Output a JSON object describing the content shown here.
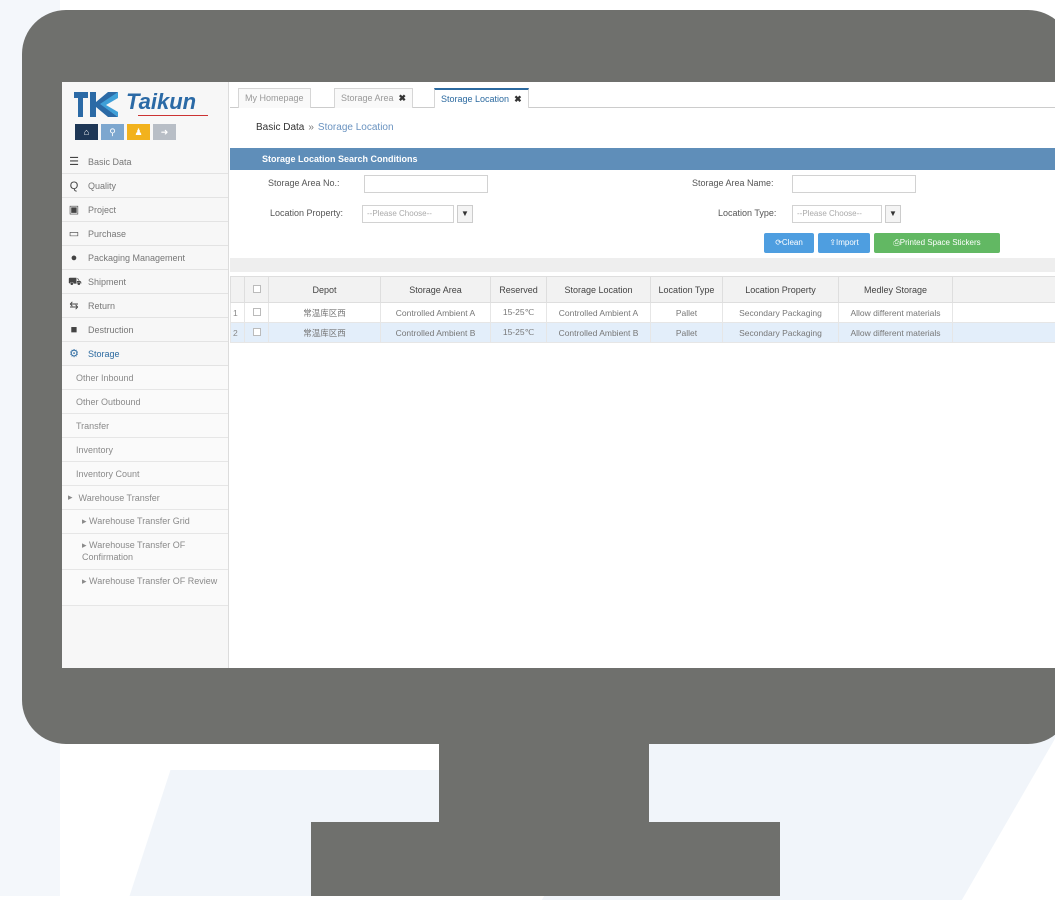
{
  "colors": {
    "monitor": "#6f706d",
    "accent": "#2c6aa0",
    "panel_header": "#5f8eb9",
    "button_blue": "#4e9ee0",
    "button_green": "#62b863",
    "selected_row": "#e3eefa"
  },
  "logo": {
    "name": "Taikun",
    "icon": "taikun-logo-mark"
  },
  "quickbar": {
    "icons": [
      "home-icon",
      "search-icon",
      "user-icon",
      "arrow-icon"
    ]
  },
  "sidebar": {
    "items": [
      {
        "label": "Basic Data",
        "icon": "database-icon"
      },
      {
        "label": "Quality",
        "icon": "search-icon"
      },
      {
        "label": "Project",
        "icon": "project-icon"
      },
      {
        "label": "Purchase",
        "icon": "laptop-icon"
      },
      {
        "label": "Packaging Management",
        "icon": "gear-icon"
      },
      {
        "label": "Shipment",
        "icon": "cart-icon"
      },
      {
        "label": "Return",
        "icon": "return-icon"
      },
      {
        "label": "Destruction",
        "icon": "destruction-icon"
      },
      {
        "label": "Storage",
        "icon": "storage-icon"
      }
    ],
    "storage_children": [
      "Other Inbound",
      "Other Outbound",
      "Transfer",
      "Inventory",
      "Inventory Count",
      "Warehouse Transfer"
    ],
    "warehouse_transfer_children": [
      "Warehouse Transfer Grid",
      "Warehouse Transfer OF Confirmation",
      "Warehouse Transfer OF Review"
    ]
  },
  "tabs": [
    {
      "label": "My Homepage",
      "closable": false
    },
    {
      "label": "Storage Area",
      "closable": true
    },
    {
      "label": "Storage Location",
      "closable": true
    }
  ],
  "breadcrumb": {
    "root": "Basic Data",
    "separator": "»",
    "current": "Storage Location"
  },
  "search": {
    "title": "Storage Location Search Conditions",
    "storage_area_no_label": "Storage Area No.:",
    "storage_area_no_value": "",
    "storage_area_name_label": "Storage Area Name:",
    "storage_area_name_value": "",
    "location_property_label": "Location Property:",
    "location_property_value": "--Please Choose--",
    "location_type_label": "Location Type:",
    "location_type_value": "--Please Choose--",
    "clear_label": "Clean",
    "import_label": "Import",
    "print_label": "Printed Space Stickers"
  },
  "table": {
    "columns": [
      "",
      "",
      "Depot",
      "Storage Area",
      "Reserved",
      "Storage Location",
      "Location Type",
      "Location Property",
      "Medley Storage"
    ],
    "rows": [
      {
        "n": "1",
        "depot": "常温库区西",
        "storage_area": "Controlled Ambient A",
        "reserved": "15-25℃",
        "storage_location": "Controlled Ambient A",
        "location_type": "Pallet",
        "location_property": "Secondary Packaging",
        "medley": "Allow different materials",
        "selected": false
      },
      {
        "n": "2",
        "depot": "常温库区西",
        "storage_area": "Controlled Ambient B",
        "reserved": "15-25℃",
        "storage_location": "Controlled Ambient B",
        "location_type": "Pallet",
        "location_property": "Secondary Packaging",
        "medley": "Allow different materials",
        "selected": true
      }
    ]
  }
}
